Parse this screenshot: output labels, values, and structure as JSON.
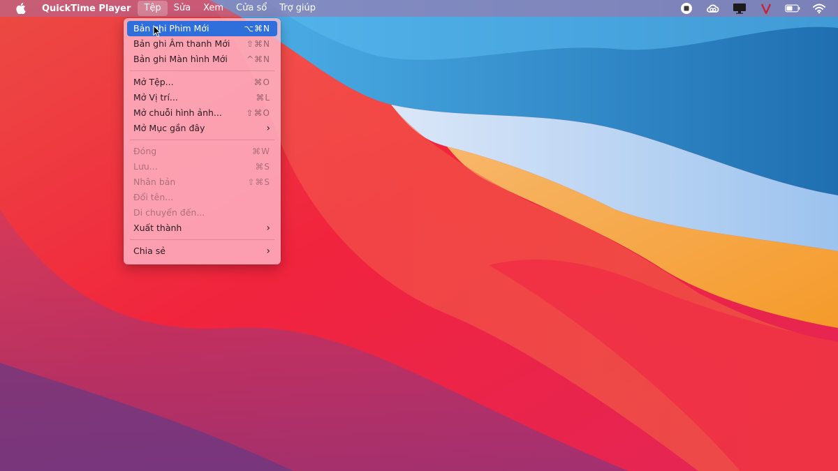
{
  "menubar": {
    "apple_icon": "apple-logo-icon",
    "app_name": "QuickTime Player",
    "menus": [
      "Tệp",
      "Sửa",
      "Xem",
      "Cửa sổ",
      "Trợ giúp"
    ],
    "active_menu": "Tệp",
    "status_icons": [
      "screen-record-icon",
      "creative-cloud-icon",
      "display-icon",
      "v-app-icon",
      "battery-icon",
      "wifi-icon"
    ]
  },
  "file_menu": {
    "groups": [
      [
        {
          "label": "Bản ghi Phim Mới",
          "shortcut": "⌥⌘N",
          "state": "highlighted"
        },
        {
          "label": "Bản ghi Âm thanh Mới",
          "shortcut": "⇧⌘N",
          "state": "enabled"
        },
        {
          "label": "Bản ghi Màn hình Mới",
          "shortcut": "^⌘N",
          "state": "enabled"
        }
      ],
      [
        {
          "label": "Mở Tệp...",
          "shortcut": "⌘O",
          "state": "enabled"
        },
        {
          "label": "Mở Vị trí...",
          "shortcut": "⌘L",
          "state": "enabled"
        },
        {
          "label": "Mở chuỗi hình ảnh...",
          "shortcut": "⇧⌘O",
          "state": "enabled"
        },
        {
          "label": "Mở Mục gần đây",
          "submenu": true,
          "state": "enabled"
        }
      ],
      [
        {
          "label": "Đóng",
          "shortcut": "⌘W",
          "state": "disabled"
        },
        {
          "label": "Lưu...",
          "shortcut": "⌘S",
          "state": "disabled"
        },
        {
          "label": "Nhân bản",
          "shortcut": "⇧⌘S",
          "state": "disabled"
        },
        {
          "label": "Đổi tên...",
          "state": "disabled"
        },
        {
          "label": "Di chuyển đến...",
          "state": "disabled"
        },
        {
          "label": "Xuất thành",
          "submenu": true,
          "state": "enabled"
        }
      ],
      [
        {
          "label": "Chia sẻ",
          "submenu": true,
          "state": "enabled"
        }
      ]
    ]
  },
  "colors": {
    "highlight": "#2f6fdb",
    "wallpaper_red": "#f0243f",
    "wallpaper_blue": "#2f8fd6",
    "wallpaper_orange": "#f6a53a"
  }
}
